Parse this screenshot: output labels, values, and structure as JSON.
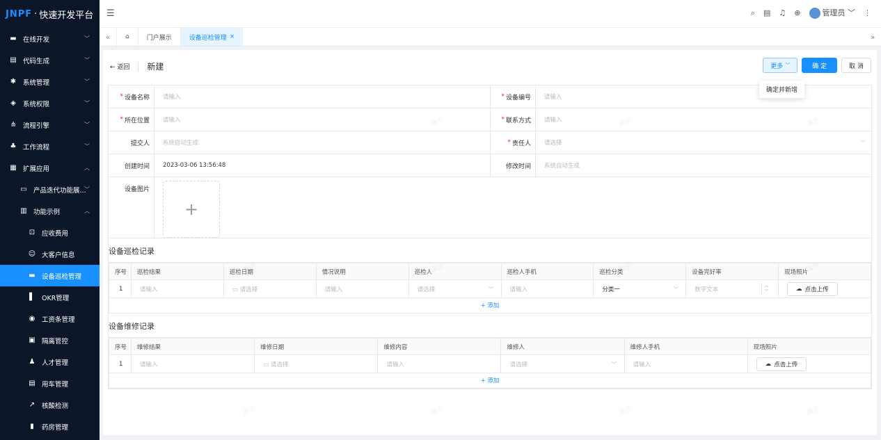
{
  "app": {
    "logo_brand": "JNPF",
    "logo_sep": "·",
    "logo_text": "快速开发平台"
  },
  "sidebar": {
    "items": [
      {
        "label": "在线开发"
      },
      {
        "label": "代码生成"
      },
      {
        "label": "系统管理"
      },
      {
        "label": "系统权限"
      },
      {
        "label": "流程引擎"
      },
      {
        "label": "工作流程"
      },
      {
        "label": "扩展应用"
      },
      {
        "label": "产品迭代功能展..."
      },
      {
        "label": "功能示例"
      },
      {
        "label": "应收费用"
      },
      {
        "label": "大客户信息"
      },
      {
        "label": "设备巡检管理"
      },
      {
        "label": "OKR管理"
      },
      {
        "label": "工资条管理"
      },
      {
        "label": "隔离管控"
      },
      {
        "label": "人才管理"
      },
      {
        "label": "用车管理"
      },
      {
        "label": "核酸检测"
      },
      {
        "label": "药房管理"
      }
    ]
  },
  "topbar": {
    "user": "管理员"
  },
  "tabs": [
    {
      "label": "门户展示"
    },
    {
      "label": "设备巡检管理"
    }
  ],
  "page": {
    "back": "← 返回",
    "title": "新建",
    "more_btn": "更多",
    "confirm_btn": "确 定",
    "cancel_btn": "取 消",
    "dropdown_item": "确定并新增"
  },
  "form": {
    "device_name": {
      "label": "设备名称",
      "placeholder": "请输入"
    },
    "device_no": {
      "label": "设备编号",
      "placeholder": "请输入"
    },
    "location": {
      "label": "所在位置",
      "placeholder": "请输入"
    },
    "contact": {
      "label": "联系方式",
      "placeholder": "请输入"
    },
    "submitter": {
      "label": "提交人",
      "value": "系统自动生成"
    },
    "owner": {
      "label": "责任人",
      "placeholder": "请选择"
    },
    "created": {
      "label": "创建时间",
      "value": "2023-03-06 13:56:48"
    },
    "modified": {
      "label": "修改时间",
      "value": "系统自动生成"
    },
    "photo": {
      "label": "设备图片",
      "plus": "+"
    }
  },
  "inspection": {
    "title": "设备巡检记录",
    "headers": [
      "序号",
      "巡检结果",
      "巡检日期",
      "情况说明",
      "巡检人",
      "巡检人手机",
      "巡检分类",
      "设备完好率",
      "现场照片"
    ],
    "row": {
      "idx": "1",
      "result": "请输入",
      "date": "请选择",
      "desc": "请输入",
      "person": "请选择",
      "phone": "请输入",
      "category": "分类一",
      "rate": "数字文本",
      "upload": "点击上传"
    },
    "add": "+ 添加"
  },
  "maintenance": {
    "title": "设备维修记录",
    "headers": [
      "序号",
      "维修结果",
      "维修日期",
      "维修内容",
      "维修人",
      "维修人手机",
      "现场照片"
    ],
    "row": {
      "idx": "1",
      "result": "请输入",
      "date": "请选择",
      "content": "请输入",
      "person": "请选择",
      "phone": "请输入",
      "upload": "点击上传"
    },
    "add": "+ 添加"
  },
  "watermark": "演示",
  "colors": {
    "accent": "#1890ff",
    "sidebar_bg": "#0b1628",
    "required": "#f5222d"
  }
}
